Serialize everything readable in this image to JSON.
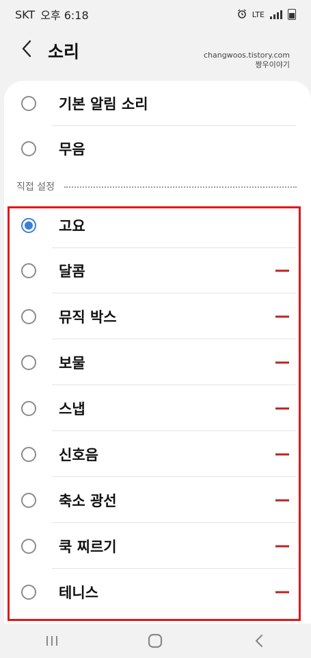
{
  "status_bar": {
    "carrier": "SKT",
    "time": "오후 6:18",
    "network": "LTE"
  },
  "header": {
    "title": "소리",
    "watermark_line1": "changwoos.tistory.com",
    "watermark_line2": "짱우이야기"
  },
  "default_options": [
    {
      "label": "기본 알림 소리",
      "selected": false
    },
    {
      "label": "무음",
      "selected": false
    }
  ],
  "section": {
    "label": "직접 설정"
  },
  "custom_options": [
    {
      "label": "고요",
      "selected": true,
      "removable": false
    },
    {
      "label": "달콤",
      "selected": false,
      "removable": true
    },
    {
      "label": "뮤직 박스",
      "selected": false,
      "removable": true
    },
    {
      "label": "보물",
      "selected": false,
      "removable": true
    },
    {
      "label": "스냅",
      "selected": false,
      "removable": true
    },
    {
      "label": "신호음",
      "selected": false,
      "removable": true
    },
    {
      "label": "축소 광선",
      "selected": false,
      "removable": true
    },
    {
      "label": "쿡 찌르기",
      "selected": false,
      "removable": true
    },
    {
      "label": "테니스",
      "selected": false,
      "removable": true
    }
  ],
  "colors": {
    "accent": "#3b7fd9",
    "remove": "#c02020",
    "highlight": "#e01818"
  }
}
